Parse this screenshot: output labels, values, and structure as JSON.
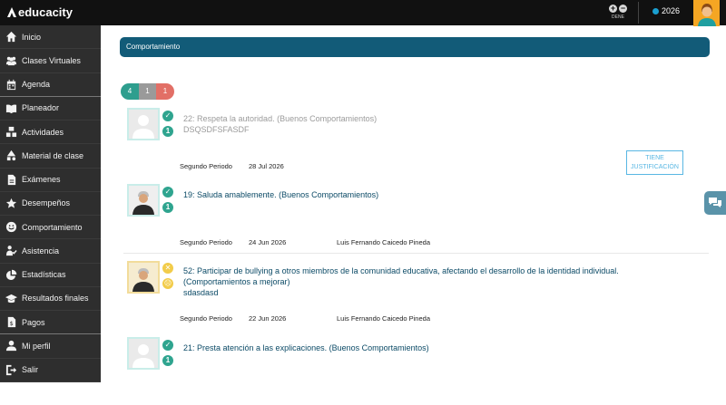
{
  "app": {
    "logo_text": "educacity"
  },
  "topbar": {
    "year": "2026",
    "zoom_label": "DENE",
    "zoom_in": "+",
    "zoom_out": "−"
  },
  "sidebar": {
    "items": [
      {
        "label": "Inicio",
        "icon": "home-icon"
      },
      {
        "label": "Clases Virtuales",
        "icon": "users-icon"
      },
      {
        "label": "Agenda",
        "icon": "calendar-icon"
      },
      {
        "label": "Planeador",
        "icon": "book-icon"
      },
      {
        "label": "Actividades",
        "icon": "blocks-icon"
      },
      {
        "label": "Material de clase",
        "icon": "shapes-icon"
      },
      {
        "label": "Exámenes",
        "icon": "file-icon"
      },
      {
        "label": "Desempeños",
        "icon": "star-icon"
      },
      {
        "label": "Comportamiento",
        "icon": "smile-icon"
      },
      {
        "label": "Asistencia",
        "icon": "person-check-icon"
      },
      {
        "label": "Estadísticas",
        "icon": "pie-chart-icon"
      },
      {
        "label": "Resultados finales",
        "icon": "graduation-cap-icon"
      },
      {
        "label": "Pagos",
        "icon": "dollar-doc-icon"
      },
      {
        "label": "Mi perfil",
        "icon": "user-icon"
      },
      {
        "label": "Salir",
        "icon": "logout-icon"
      }
    ]
  },
  "main": {
    "header": "Comportamiento",
    "counters": {
      "good": "4",
      "neutral": "1",
      "bad": "1"
    },
    "justification_button": "TIENE JUSTIFICACIÓN",
    "entries": [
      {
        "title": "22: Respeta la autoridad. (Buenos Comportamientos)",
        "subtitle": "DSQSDFSFASDF",
        "period": "Segundo Periodo",
        "date": "28 Jul 2026",
        "teacher": "",
        "badge": "✓",
        "count": "1"
      },
      {
        "title": "19: Saluda amablemente. (Buenos Comportamientos)",
        "subtitle": "",
        "period": "Segundo Periodo",
        "date": "24 Jun 2026",
        "teacher": "Luis Fernando Caicedo Pineda",
        "badge": "✓",
        "count": "1"
      },
      {
        "title": "52: Participar de bullying a otros miembros de la comunidad educativa, afectando el desarrollo de la identidad individual.",
        "title2": "(Comportamientos a mejorar)",
        "subtitle": "sdasdasd",
        "period": "Segundo Periodo",
        "date": "22 Jun 2026",
        "teacher": "Luis Fernando Caicedo Pineda",
        "badge": "✕",
        "count": "☹"
      },
      {
        "title": "21: Presta atención a las explicaciones. (Buenos Comportamientos)",
        "subtitle": "",
        "period": "",
        "date": "",
        "teacher": "",
        "badge": "✓",
        "count": "1"
      }
    ]
  },
  "colors": {
    "topbar": "#111111",
    "sidebar": "#2e2e2e",
    "header": "#125b78",
    "good": "#2e9e8e",
    "bad": "#e26f66",
    "neutral": "#9a9a9a",
    "accent": "#59b7e3"
  }
}
